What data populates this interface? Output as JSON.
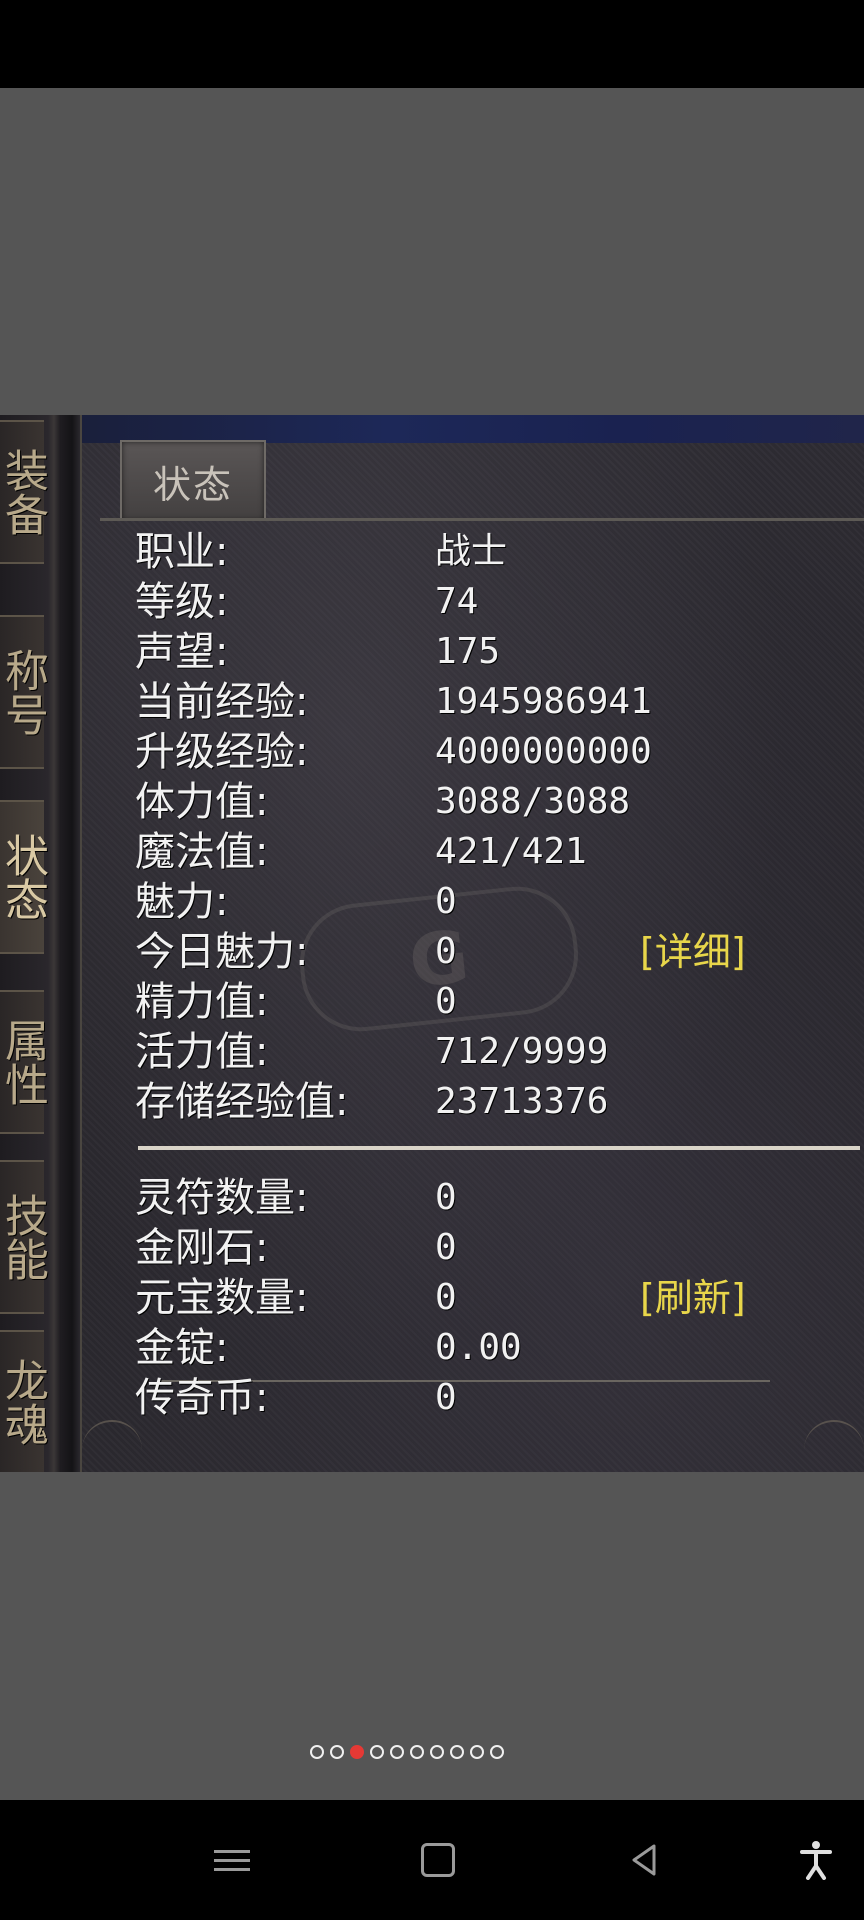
{
  "side_tabs": [
    {
      "label": "装备",
      "active": false
    },
    {
      "label": "称号",
      "active": false
    },
    {
      "label": "状态",
      "active": true
    },
    {
      "label": "属性",
      "active": false
    },
    {
      "label": "技能",
      "active": false
    },
    {
      "label": "龙魂",
      "active": false
    }
  ],
  "panel": {
    "tab_title": "状态",
    "watermark": "G"
  },
  "stats": [
    {
      "label": "职业:",
      "value": "战士"
    },
    {
      "label": "等级:",
      "value": "74"
    },
    {
      "label": "声望:",
      "value": "175"
    },
    {
      "label": "当前经验:",
      "value": "1945986941"
    },
    {
      "label": "升级经验:",
      "value": "4000000000"
    },
    {
      "label": "体力值:",
      "value": "3088/3088"
    },
    {
      "label": "魔法值:",
      "value": "421/421"
    },
    {
      "label": "魅力:",
      "value": "0"
    },
    {
      "label": "今日魅力:",
      "value": "0",
      "action": "[详细]"
    },
    {
      "label": "精力值:",
      "value": "0"
    },
    {
      "label": "活力值:",
      "value": "712/9999"
    },
    {
      "label": "存储经验值:",
      "value": "23713376"
    }
  ],
  "currency": [
    {
      "label": "灵符数量:",
      "value": "0"
    },
    {
      "label": "金刚石:",
      "value": "0"
    },
    {
      "label": "元宝数量:",
      "value": "0",
      "action": "[刷新]"
    },
    {
      "label": "金锭:",
      "value": "0.00"
    },
    {
      "label": "传奇币:",
      "value": "0"
    }
  ],
  "pager": {
    "total": 10,
    "current_index": 2
  },
  "colors": {
    "action_text": "#e8d64a",
    "page_dot_active": "#e53935"
  }
}
